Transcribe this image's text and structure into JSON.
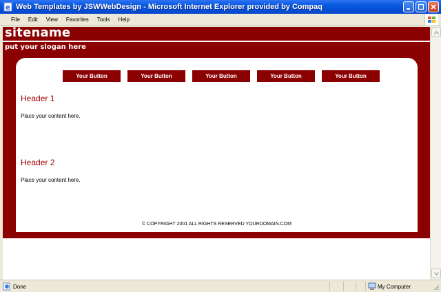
{
  "window": {
    "title": "Web Templates by JSWWebDesign - Microsoft Internet Explorer provided by Compaq"
  },
  "menu": {
    "items": [
      "File",
      "Edit",
      "View",
      "Favorites",
      "Tools",
      "Help"
    ]
  },
  "site": {
    "name": "sitename",
    "slogan": "put your slogan here",
    "nav": [
      "Your Button",
      "Your Button",
      "Your Button",
      "Your Button",
      "Your Button"
    ],
    "sections": [
      {
        "header": "Header 1",
        "body": "Place your content here."
      },
      {
        "header": "Header 2",
        "body": "Place your content here."
      }
    ],
    "footer": "© COPYRIGHT 2001 ALL RIGHTS RESERVED YOURDOMAIN.COM"
  },
  "status": {
    "left": "Done",
    "zone": "My Computer"
  },
  "colors": {
    "brand": "#8b0000",
    "header_text": "#a00000",
    "xp_title": "#0a5ae0"
  }
}
